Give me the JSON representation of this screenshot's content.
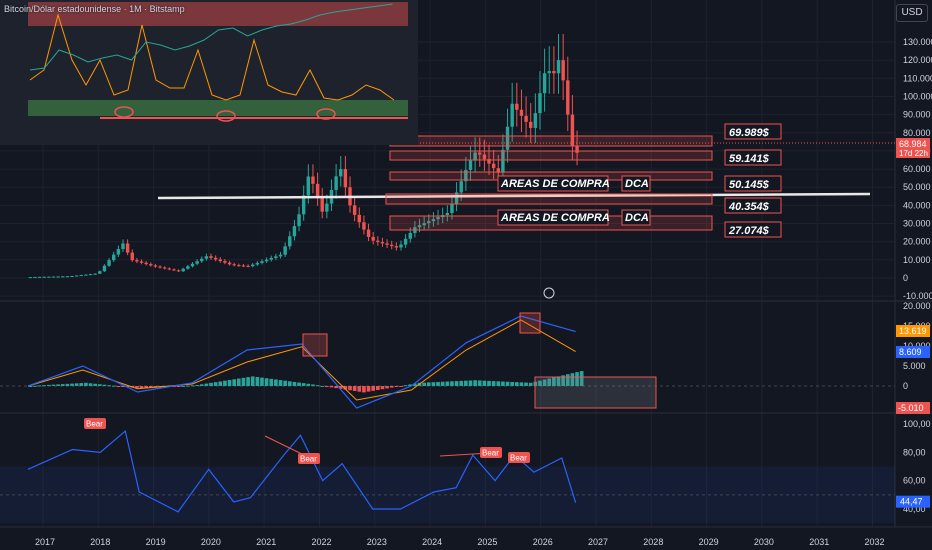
{
  "header": {
    "symbol_title": "Bitcoin/Dólar estadounidense · 1M · Bitstamp",
    "currency_badge": "USD"
  },
  "colors": {
    "background": "#131722",
    "up": "#26a69a",
    "down": "#ef5350",
    "macd_line": "#2962ff",
    "signal_line": "#ff9800",
    "rsi_line": "#2962ff",
    "zone": "#ef5350",
    "grid": "#1e222d"
  },
  "price_axis": {
    "labels": [
      "130.000",
      "120.000",
      "110.000",
      "100.000",
      "90.000",
      "80.000",
      "70.000",
      "60.000",
      "50.000",
      "40.000",
      "30.000",
      "20.000",
      "10.000",
      "0",
      "-10.000"
    ],
    "current_price": "68.984",
    "countdown": "17d 22h"
  },
  "macd_axis": {
    "labels": [
      "20.000",
      "15.000",
      "10.000",
      "5.000",
      "0"
    ],
    "macd_value": "8.609",
    "signal_value": "13.619",
    "hist_value": "-5.010"
  },
  "rsi_axis": {
    "labels": [
      "100,00",
      "80,00",
      "60,00",
      "40,00"
    ],
    "rsi_value": "44,47"
  },
  "time_axis": [
    "2017",
    "2018",
    "2019",
    "2020",
    "2021",
    "2022",
    "2023",
    "2024",
    "2025",
    "2026",
    "2027",
    "2028",
    "2029",
    "2030",
    "2031",
    "2032"
  ],
  "annotations": {
    "buy_zone_label": "AREAS DE COMPRA",
    "dca_label": "DCA",
    "levels": [
      "69.989$",
      "59.141$",
      "50.145$",
      "40.354$",
      "27.074$"
    ],
    "bear_label": "Bear"
  },
  "chart_data": [
    {
      "type": "line",
      "title": "Bitcoin/Dólar estadounidense · 1M · Bitstamp",
      "x": [
        "2017",
        "2018",
        "2019",
        "2020",
        "2021",
        "2022",
        "2023",
        "2024",
        "2025",
        "2026"
      ],
      "y": [
        1000,
        14000,
        3800,
        7200,
        29000,
        47000,
        16500,
        42000,
        94000,
        69000
      ],
      "series": [
        {
          "values": [
            1000,
            14000,
            3800,
            7200,
            29000,
            47000,
            16500,
            42000,
            94000,
            69000
          ]
        }
      ],
      "ylim": [
        -10000,
        130000
      ],
      "key_prices": {
        "ath": 125000,
        "cycle_peak_2021": 69000,
        "low_2022": 15500,
        "current": 68984
      },
      "horizontal_levels": [
        69989,
        59141,
        50145,
        40354,
        27074
      ],
      "trendline_level": 42000
    },
    {
      "type": "line",
      "xlim": [
        "2017",
        "2026"
      ],
      "series": [
        {
          "values": [
            0,
            5000,
            -1500,
            800,
            9000,
            10500,
            -5500,
            0,
            10800,
            17500,
            13619
          ]
        },
        {
          "values": [
            0,
            4000,
            -700,
            500,
            6000,
            9800,
            -3500,
            -1000,
            9000,
            16500,
            8609
          ]
        }
      ],
      "histogram_last": -5010,
      "ylim": [
        -6000,
        22000
      ]
    },
    {
      "type": "line",
      "x": [
        "2017",
        "2018",
        "2019",
        "2020",
        "2021",
        "2022",
        "2023",
        "2024",
        "2025",
        "2026"
      ],
      "y": [
        68,
        95,
        50,
        55,
        92,
        60,
        45,
        52,
        72,
        44.47
      ],
      "ylim": [
        35,
        100
      ],
      "band": [
        30,
        70
      ]
    }
  ]
}
